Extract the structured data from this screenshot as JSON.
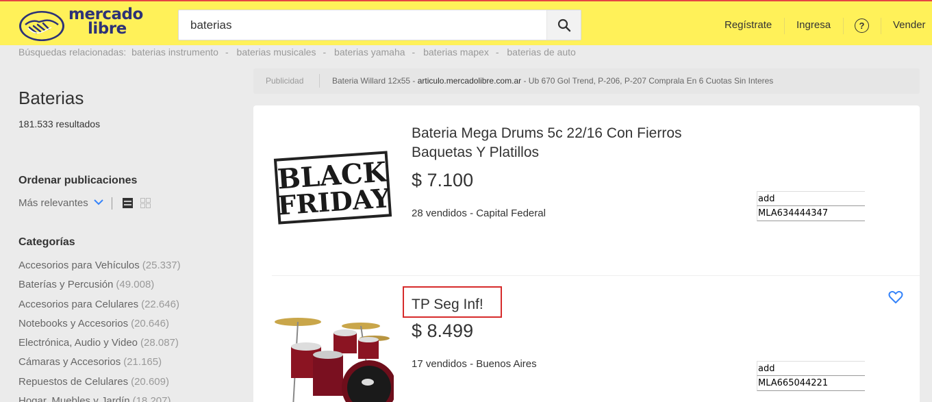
{
  "header": {
    "logo_line1": "mercado",
    "logo_line2": "libre",
    "search_value": "baterias",
    "nav": [
      "Regístrate",
      "Ingresa",
      "Vender"
    ],
    "help_label": "?"
  },
  "related": {
    "label": "Búsquedas relacionadas:",
    "items": [
      "baterias instrumento",
      "baterias musicales",
      "baterias yamaha",
      "baterias mapex",
      "baterias de auto"
    ]
  },
  "ad": {
    "label": "Publicidad",
    "title": "Bateria Willard 12x55 - ",
    "domain": "articulo.mercadolibre.com.ar",
    "desc": " - Ub 670 Gol Trend, P-206, P-207 Comprala En 6 Cuotas Sin Interes"
  },
  "sidebar": {
    "title": "Baterias",
    "count": "181.533 resultados",
    "sort_heading": "Ordenar publicaciones",
    "sort_value": "Más relevantes",
    "cat_heading": "Categorías",
    "categories": [
      {
        "name": "Accesorios para Vehículos",
        "count": "(25.337)"
      },
      {
        "name": "Baterías y Percusión",
        "count": "(49.008)"
      },
      {
        "name": "Accesorios para Celulares",
        "count": "(22.646)"
      },
      {
        "name": "Notebooks y Accesorios",
        "count": "(20.646)"
      },
      {
        "name": "Electrónica, Audio y Video",
        "count": "(28.087)"
      },
      {
        "name": "Cámaras y Accesorios",
        "count": "(21.165)"
      },
      {
        "name": "Repuestos de Celulares",
        "count": "(20.609)"
      },
      {
        "name": "Hogar, Muebles y Jardín",
        "count": "(18.207)"
      }
    ]
  },
  "items": [
    {
      "title": "Bateria Mega Drums 5c 22/16 Con Fierros Baquetas Y Platillos",
      "price": "$ 7.100",
      "meta": "28 vendidos - Capital Federal",
      "img_text_1": "BLACK",
      "img_text_2": "FRIDAY",
      "table": [
        "add",
        "MLA634444347"
      ]
    },
    {
      "title": "TP Seg Inf!",
      "price": "$ 8.499",
      "meta": "17 vendidos - Buenos Aires",
      "table": [
        "add",
        "MLA665044221"
      ]
    }
  ],
  "colors": {
    "header_bg": "#fff159",
    "brand_blue": "#2d3277",
    "link_blue": "#3483fa",
    "highlight_red": "#d62b2b"
  }
}
